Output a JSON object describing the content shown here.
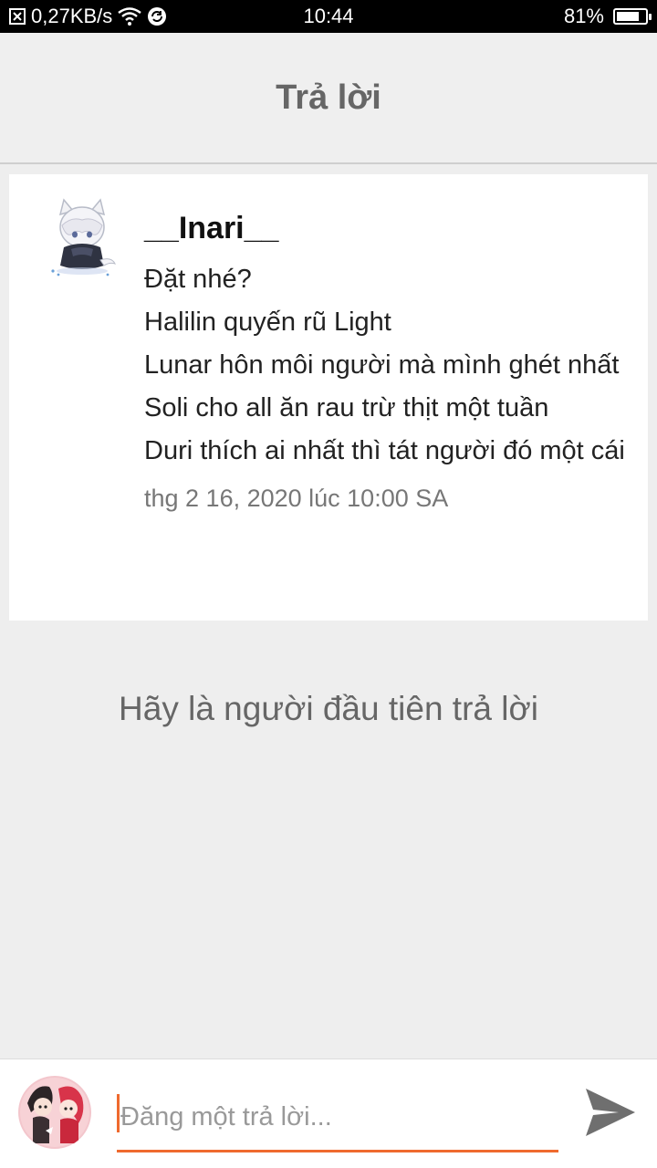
{
  "status_bar": {
    "network_speed": "0,27KB/s",
    "time": "10:44",
    "battery_percent": "81%",
    "battery_level": 0.81,
    "icons": [
      "notification-icon",
      "wifi-icon",
      "sync-icon",
      "battery-icon"
    ]
  },
  "header": {
    "title": "Trả lời"
  },
  "post": {
    "author": "__Inari__",
    "lines": [
      "Đặt nhé?",
      "Halilin quyến rũ Light",
      "Lunar hôn môi người mà mình ghét nhất",
      "Soli cho all ăn rau trừ thịt một tuần",
      "Duri thích ai nhất thì tát người đó một cái"
    ],
    "timestamp": "thg 2 16, 2020 lúc 10:00 SA"
  },
  "empty_state": "Hãy là người đầu tiên trả lời",
  "composer": {
    "placeholder": "Đăng một trả lời...",
    "value": ""
  },
  "colors": {
    "accent": "#ef6a2e",
    "background": "#eeeeee",
    "header_text": "#666666"
  }
}
